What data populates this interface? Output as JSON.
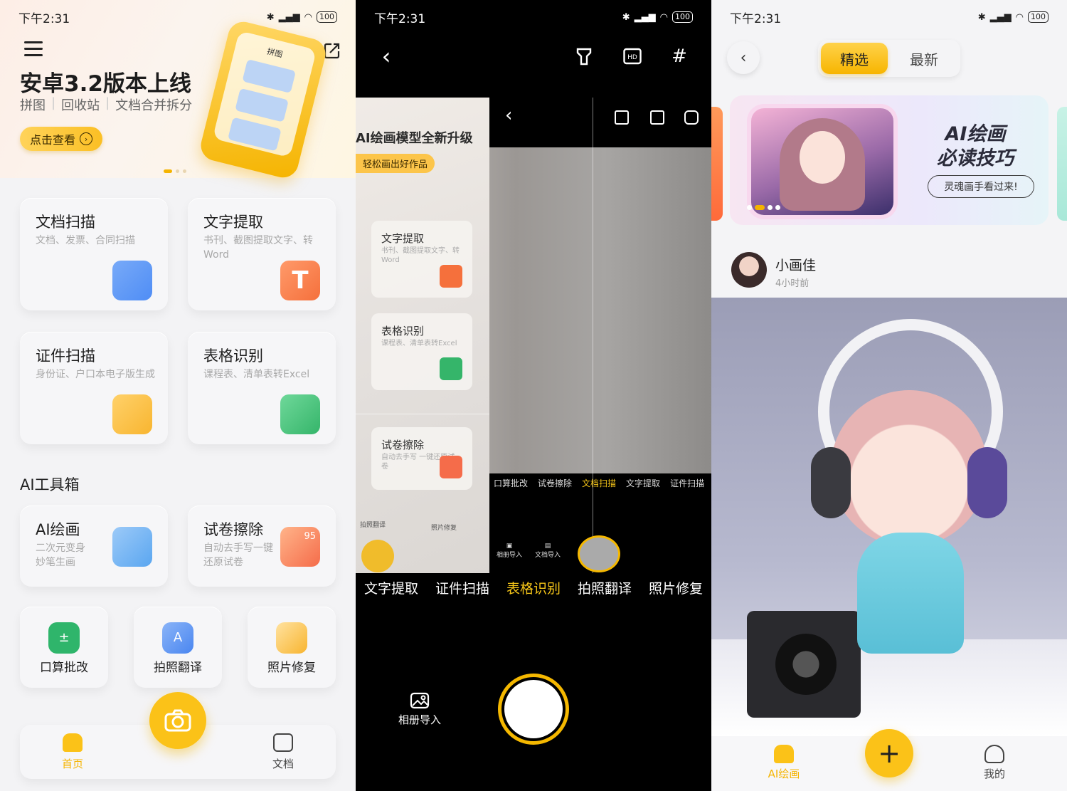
{
  "status": {
    "time": "下午2:31",
    "battery": "100",
    "signal": "HD"
  },
  "screen1": {
    "hero": {
      "title": "安卓3.2版本上线",
      "features": [
        "拼图",
        "回收站",
        "文档合并拆分"
      ],
      "button": "点击查看",
      "art_label": "拼图"
    },
    "cards": [
      {
        "title": "文档扫描",
        "desc": "文档、发票、合同扫描",
        "icon": "document-scan-icon",
        "color": "#4f8df5"
      },
      {
        "title": "文字提取",
        "desc": "书刊、截图提取文字、转Word",
        "icon": "text-extract-icon",
        "color": "#f5703c"
      },
      {
        "title": "证件扫描",
        "desc": "身份证、户口本电子版生成",
        "icon": "id-card-icon",
        "color": "#f8b530"
      },
      {
        "title": "表格识别",
        "desc": "课程表、清单表转Excel",
        "icon": "table-icon",
        "color": "#35b56a"
      }
    ],
    "section_title": "AI工具箱",
    "ai_cards": [
      {
        "title": "AI绘画",
        "desc": "二次元变身妙笔生画",
        "icon": "paint-brush-icon",
        "color": "#5aa6f0"
      },
      {
        "title": "试卷擦除",
        "desc": "自动去手写一键还原试卷",
        "icon": "exam-erase-icon",
        "color": "#f56c4a",
        "badge": "95"
      }
    ],
    "small_cards": [
      {
        "title": "口算批改",
        "icon": "calculator-icon",
        "color": "#2fb56b"
      },
      {
        "title": "拍照翻译",
        "icon": "translate-icon",
        "color": "#4a86f0"
      },
      {
        "title": "照片修复",
        "icon": "photo-repair-icon",
        "color": "#f8b530"
      }
    ],
    "tabbar": {
      "home": "首页",
      "docs": "文档"
    }
  },
  "screen2": {
    "ghost": {
      "title": "AI绘画模型全新升级",
      "pill": "轻松画出好作品",
      "cards": [
        {
          "title": "文字提取",
          "desc": "书刊、截图提取文字、转Word"
        },
        {
          "title": "表格识别",
          "desc": "课程表、清单表转Excel"
        },
        {
          "title": "试卷擦除",
          "desc": "自动去手写 一键还原试卷"
        }
      ],
      "small": [
        "拍照翻译",
        "照片修复"
      ]
    },
    "mini_modes": [
      "口算批改",
      "试卷擦除",
      "文档扫描",
      "文字提取",
      "证件扫描"
    ],
    "mini_active": "文档扫描",
    "mini_import": [
      "相册导入",
      "文档导入"
    ],
    "modes": [
      "文字提取",
      "证件扫描",
      "表格识别",
      "拍照翻译",
      "照片修复"
    ],
    "active_mode": "表格识别",
    "album": "相册导入",
    "accent": "#f5c518"
  },
  "screen3": {
    "tabs": {
      "featured": "精选",
      "latest": "最新"
    },
    "banner": {
      "title_line1": "AI绘画",
      "title_line2": "必读技巧",
      "pill": "灵魂画手看过来!"
    },
    "user": {
      "name": "小画佳",
      "time": "4小时前"
    },
    "tabbar": {
      "ai": "AI绘画",
      "mine": "我的"
    },
    "accent": "#fbc218"
  }
}
